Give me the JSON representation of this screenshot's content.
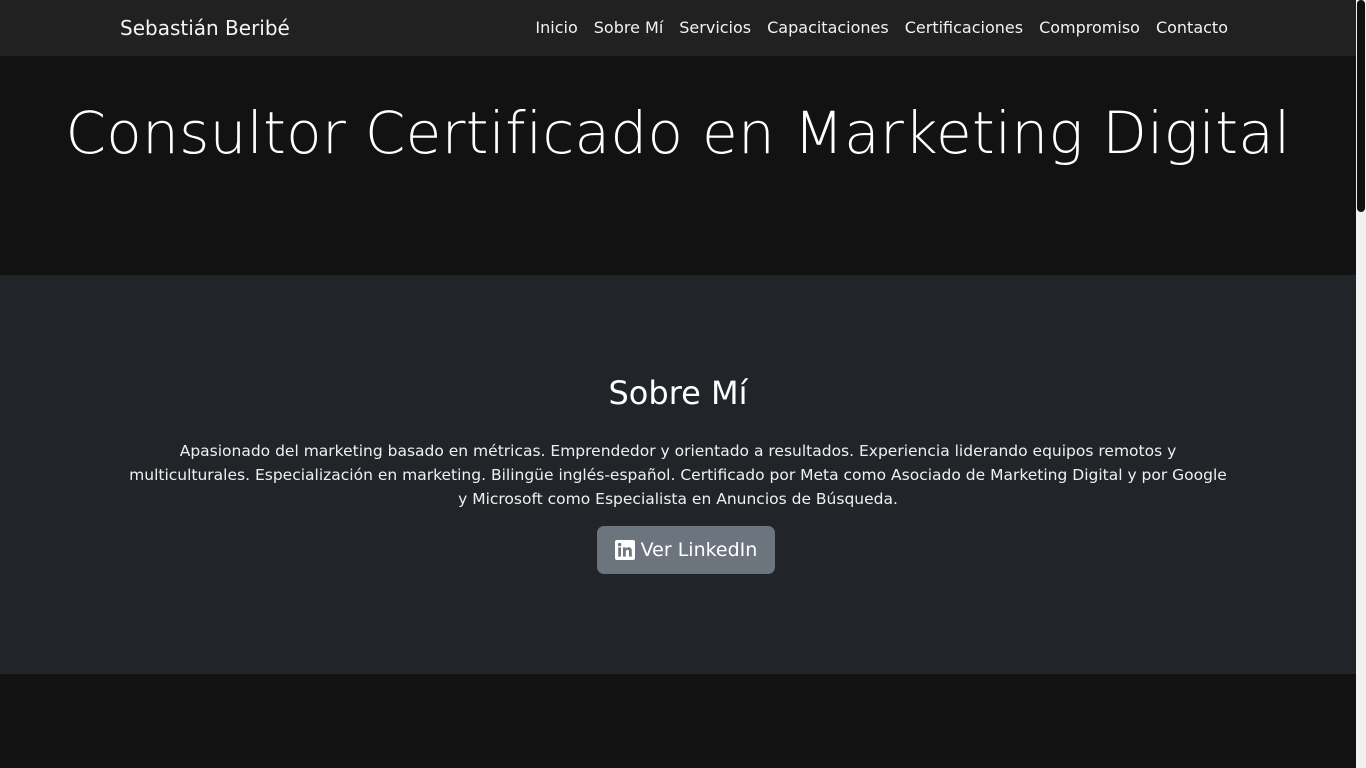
{
  "navbar": {
    "brand": "Sebastián Beribé",
    "links": [
      "Inicio",
      "Sobre Mí",
      "Servicios",
      "Capacitaciones",
      "Certificaciones",
      "Compromiso",
      "Contacto"
    ]
  },
  "hero": {
    "title": "Consultor Certificado en Marketing Digital"
  },
  "about": {
    "title": "Sobre Mí",
    "text": "Apasionado del marketing basado en métricas. Emprendedor y orientado a resultados. Experiencia liderando equipos remotos y multiculturales. Especialización en marketing. Bilingüe inglés-español. Certificado por Meta como Asociado de Marketing Digital y por Google y Microsoft como Especialista en Anuncios de Búsqueda.",
    "button_label": "Ver LinkedIn",
    "button_icon": "linkedin-icon"
  },
  "colors": {
    "navbar_bg": "#212121",
    "hero_bg": "#121212",
    "about_bg": "#212529",
    "button_bg": "#6c757d"
  }
}
